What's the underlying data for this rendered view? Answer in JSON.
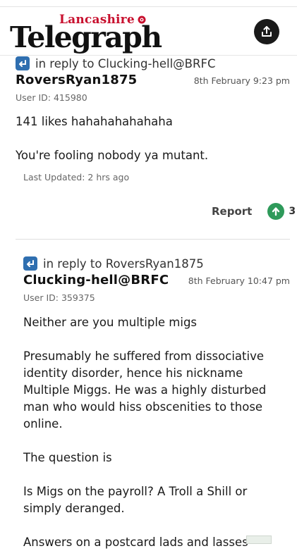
{
  "header": {
    "brand_small": "Lancashire",
    "brand_big": "Telegraph"
  },
  "comments": [
    {
      "reply_to": "in reply to Clucking-hell@BRFC",
      "author": "RoversRyan1875",
      "date": "8th February 9:23 pm",
      "user_id": "User ID: 415980",
      "paragraphs": [
        "141 likes hahahahahahaha",
        "You're fooling nobody ya mutant."
      ],
      "last_updated": "Last Updated: 2 hrs ago",
      "report_label": "Report",
      "votes": "3"
    },
    {
      "reply_to": "in reply to RoversRyan1875",
      "author": "Clucking-hell@BRFC",
      "date": "8th February 10:47 pm",
      "user_id": "User ID: 359375",
      "paragraphs": [
        "Neither are you multiple migs",
        "Presumably he suffered from dissociative identity disorder, hence his nickname Multiple Miggs. He was a highly disturbed man who would hiss obscenities to those online.",
        "The question is",
        "Is Migs on the payroll? A Troll a Shill or simply deranged.",
        "Answers on a postcard lads and lasses"
      ]
    }
  ],
  "colors": {
    "brand_red": "#c8102e",
    "reply_icon_blue": "#2f6fb0",
    "upvote_green": "#2e9a5a"
  }
}
